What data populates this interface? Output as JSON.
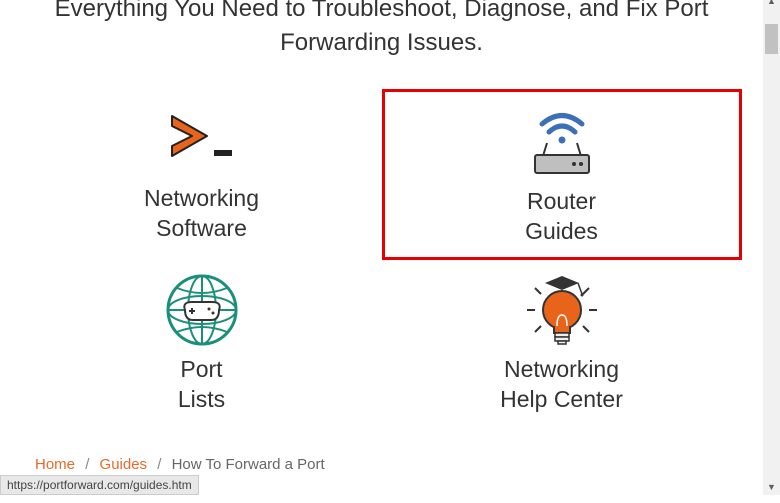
{
  "header": {
    "line1": "Everything You Need to Troubleshoot, Diagnose, and Fix Port",
    "line2": "Forwarding Issues."
  },
  "cards": {
    "networking_software": "Networking\nSoftware",
    "router_guides": "Router\nGuides",
    "port_lists": "Port\nLists",
    "networking_help_center": "Networking\nHelp Center"
  },
  "breadcrumb": {
    "home": "Home",
    "guides": "Guides",
    "current": "How To Forward a Port"
  },
  "status_url": "https://portforward.com/guides.htm"
}
